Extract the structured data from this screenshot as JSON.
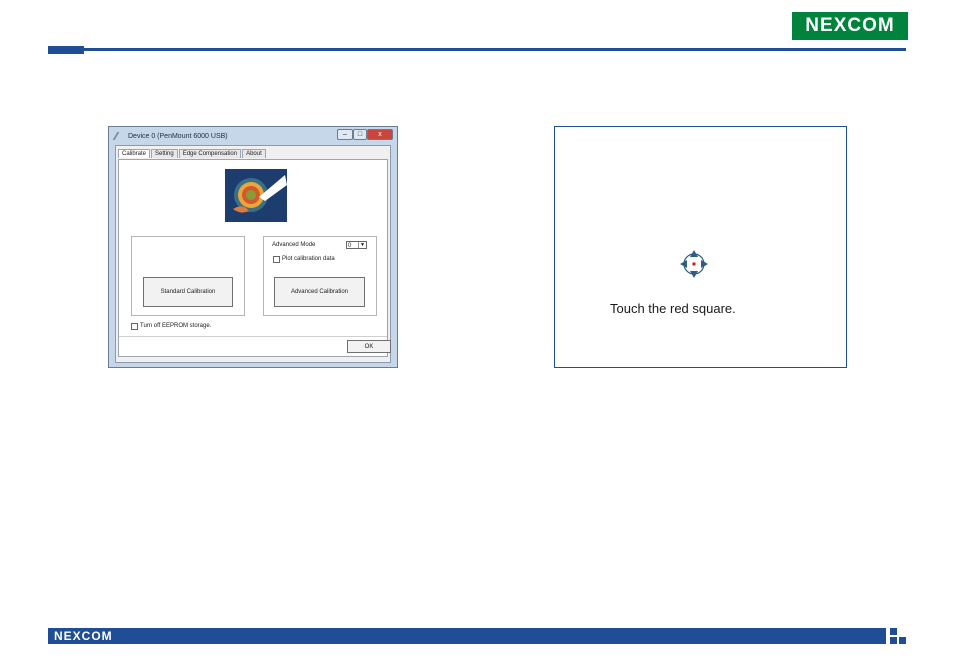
{
  "header": {
    "brand": "NE",
    "brand_x": "X",
    "brand_end": "COM"
  },
  "footer": {
    "brand": "NEXCOM"
  },
  "dialog": {
    "title": "Device 0 (PenMount 6000 USB)",
    "close": "x",
    "tabs": [
      "Calibrate",
      "Setting",
      "Edge Compensation",
      "About"
    ],
    "standard_calibration": "Standard Calibration",
    "advanced_mode_label": "Advanced Mode",
    "advanced_mode_value": "0",
    "plot_calibration_label": "Plot calibration data",
    "advanced_calibration": "Advanced Calibration",
    "eeprom_label": "Turn off EEPROM storage.",
    "ok": "OK"
  },
  "calibration": {
    "message": "Touch the red square."
  }
}
